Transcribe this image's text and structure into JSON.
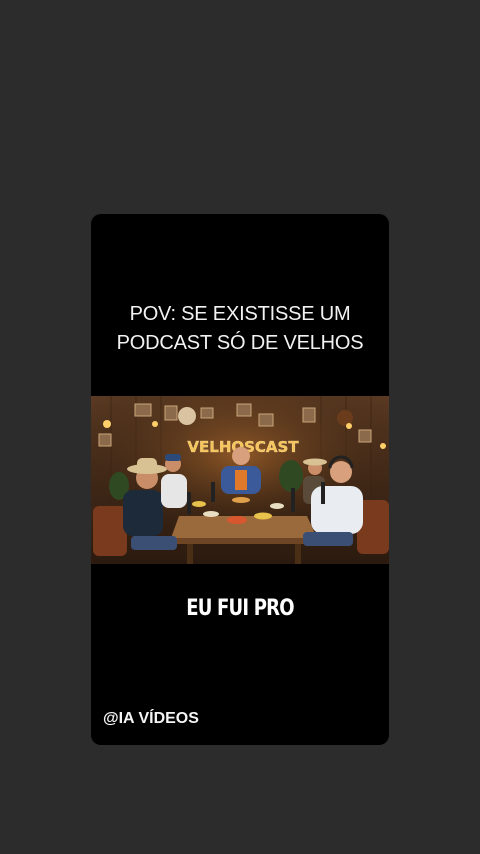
{
  "post": {
    "caption_line1": "POV: SE EXISTISSE UM",
    "caption_line2": "PODCAST SÓ DE VELHOS",
    "media_sign": "VELHOSCAST",
    "subtitle": "EU FUI PRO",
    "watermark": "@IA VÍDEOS"
  },
  "colors": {
    "background": "#2d2c2d",
    "card": "#000000",
    "sign": "#f6c45a"
  }
}
